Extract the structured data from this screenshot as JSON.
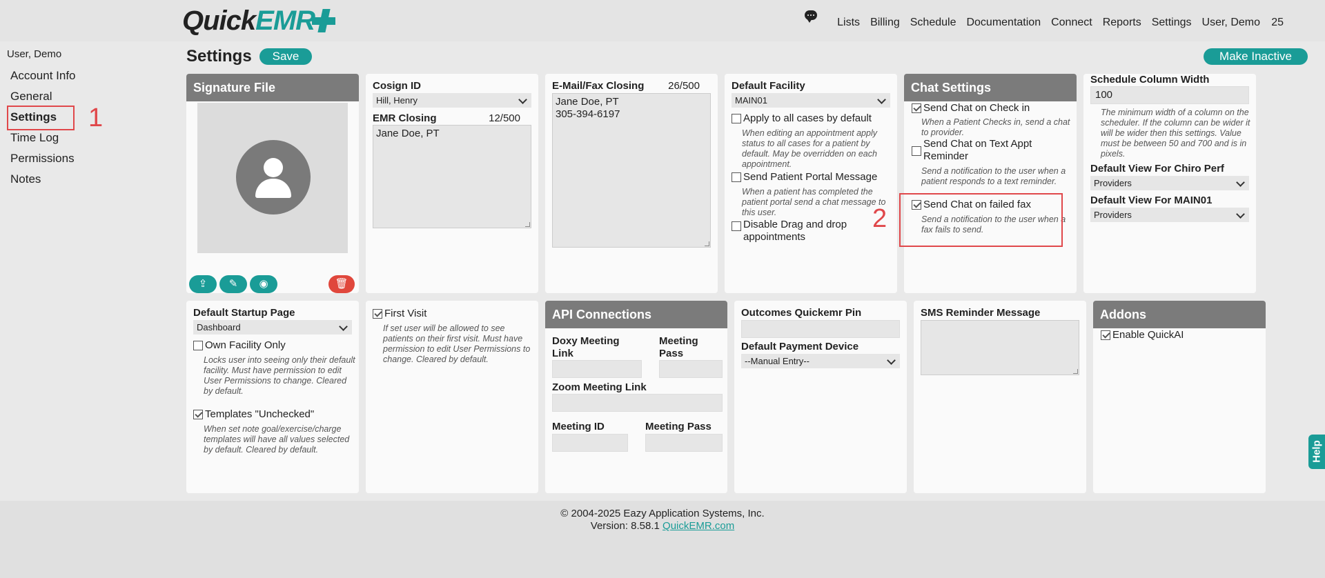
{
  "header": {
    "logo_part1": "Quick",
    "logo_part2": "EMR",
    "nav": [
      "Lists",
      "Billing",
      "Schedule",
      "Documentation",
      "Connect",
      "Reports",
      "Settings",
      "User, Demo"
    ],
    "nav_count": "25"
  },
  "sidebar": {
    "user": "User, Demo",
    "items": [
      "Account Info",
      "General",
      "Settings",
      "Time Log",
      "Permissions",
      "Notes"
    ],
    "active": "Settings"
  },
  "annotations": [
    "1",
    "2"
  ],
  "page": {
    "title": "Settings",
    "save_label": "Save",
    "make_inactive_label": "Make Inactive"
  },
  "signature": {
    "title": "Signature File",
    "buttons": [
      "upload-icon",
      "sign-icon",
      "camera-icon",
      "trash-icon"
    ]
  },
  "cosign": {
    "cosign_label": "Cosign ID",
    "cosign_value": "Hill, Henry",
    "emr_label": "EMR Closing",
    "emr_count": "12/500",
    "emr_value": "Jane Doe, PT"
  },
  "email": {
    "label": "E-Mail/Fax Closing",
    "count": "26/500",
    "value": "Jane Doe, PT\n305-394-6197"
  },
  "facility": {
    "label": "Default Facility",
    "value": "MAIN01",
    "opt1_label": "Apply to all cases by default",
    "opt1_hint": "When editing an appointment apply status to all cases for a patient by default. May be overridden on each appointment.",
    "opt2_label": "Send Patient Portal Message",
    "opt2_hint": "When a patient has completed the patient portal send a chat message to this user.",
    "opt3_label": "Disable Drag and drop appointments"
  },
  "chat": {
    "title": "Chat Settings",
    "opt1_label": "Send Chat on Check in",
    "opt1_hint": "When a Patient Checks in, send a chat to provider.",
    "opt2_label": "Send Chat on Text Appt Reminder",
    "opt2_hint": "Send a notification to the user when a patient responds to a text reminder.",
    "opt3_label": "Send Chat on failed fax",
    "opt3_hint": "Send a notification to the user when a fax fails to send."
  },
  "schedule": {
    "col_label": "Schedule Column Width",
    "col_value": "100",
    "col_hint": "The minimum width of a column on the scheduler. If the column can be wider it will be wider then this settings. Value must be between 50 and 700 and is in pixels.",
    "chiro_label": "Default View For Chiro Perf",
    "chiro_value": "Providers",
    "main_label": "Default View For MAIN01",
    "main_value": "Providers"
  },
  "startup": {
    "label": "Default Startup Page",
    "value": "Dashboard",
    "opt1_label": "Own Facility Only",
    "opt1_hint": "Locks user into seeing only their default facility. Must have permission to edit User Permissions to change. Cleared by default.",
    "opt2_label": "Templates \"Unchecked\"",
    "opt2_hint": "When set note goal/exercise/charge templates will have all values selected by default. Cleared by default."
  },
  "firstvisit": {
    "label": "First Visit",
    "hint": "If set user will be allowed to see patients on their first visit. Must have permission to edit User Permissions to change. Cleared by default."
  },
  "api": {
    "title": "API Connections",
    "doxy_link_label": "Doxy Meeting Link",
    "doxy_pass_label": "Meeting Pass",
    "zoom_link_label": "Zoom Meeting Link",
    "meeting_id_label": "Meeting ID",
    "meeting_pass_label": "Meeting Pass"
  },
  "outcomes": {
    "pin_label": "Outcomes Quickemr Pin",
    "payment_label": "Default Payment Device",
    "payment_value": "--Manual Entry--"
  },
  "sms": {
    "label": "SMS Reminder Message"
  },
  "addons": {
    "title": "Addons",
    "opt1_label": "Enable QuickAI"
  },
  "help_label": "Help",
  "footer": {
    "copyright": "© 2004-2025 Eazy Application Systems, Inc.",
    "version": "Version: 8.58.1",
    "link": "QuickEMR.com"
  }
}
